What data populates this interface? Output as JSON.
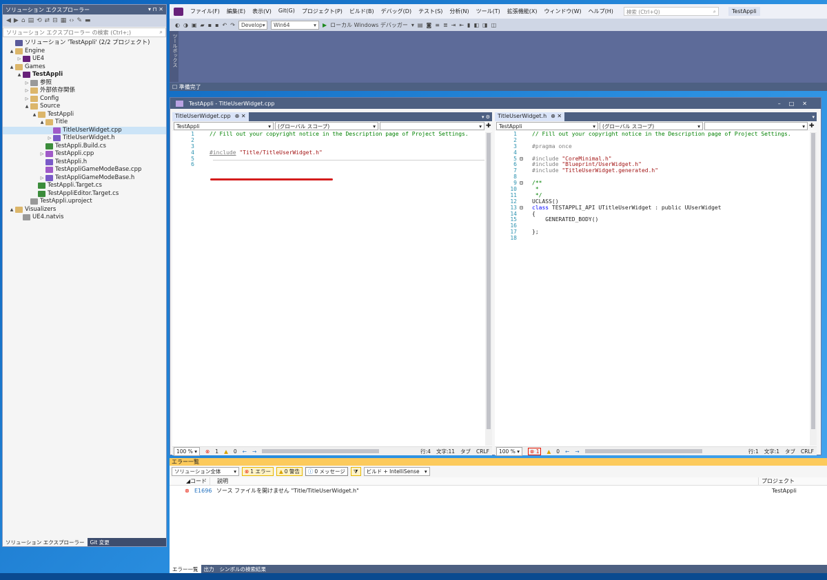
{
  "solution_explorer": {
    "title": "ソリューション エクスプローラー",
    "title_controls": "▾ ⊓ ✕",
    "search_placeholder": "ソリューション エクスプローラー の検索 (Ctrl+;)",
    "tree": [
      {
        "label": "ソリューション 'TestAppli' (2/2 プロジェクト)",
        "depth": 0,
        "expand": "",
        "icon": "solution-icon",
        "bold": false
      },
      {
        "label": "Engine",
        "depth": 0,
        "expand": "▲",
        "icon": "folder-icon",
        "bold": false
      },
      {
        "label": "UE4",
        "depth": 1,
        "expand": "▷",
        "icon": "project-icon",
        "bold": false
      },
      {
        "label": "Games",
        "depth": 0,
        "expand": "▲",
        "icon": "folder-icon",
        "bold": false
      },
      {
        "label": "TestAppli",
        "depth": 1,
        "expand": "▲",
        "icon": "project-icon",
        "bold": true
      },
      {
        "label": "参照",
        "depth": 2,
        "expand": "▷",
        "icon": "references-icon",
        "bold": false
      },
      {
        "label": "外部依存関係",
        "depth": 2,
        "expand": "▷",
        "icon": "external-deps-icon",
        "bold": false
      },
      {
        "label": "Config",
        "depth": 2,
        "expand": "▷",
        "icon": "folder-icon",
        "bold": false
      },
      {
        "label": "Source",
        "depth": 2,
        "expand": "▲",
        "icon": "folder-icon",
        "bold": false
      },
      {
        "label": "TestAppli",
        "depth": 3,
        "expand": "▲",
        "icon": "folder-icon",
        "bold": false
      },
      {
        "label": "Title",
        "depth": 4,
        "expand": "▲",
        "icon": "folder-icon",
        "bold": false
      },
      {
        "label": "TitleUserWidget.cpp",
        "depth": 5,
        "expand": "",
        "icon": "cpp-file-icon",
        "bold": false,
        "selected": true
      },
      {
        "label": "TitleUserWidget.h",
        "depth": 5,
        "expand": "▷",
        "icon": "header-file-icon",
        "bold": false
      },
      {
        "label": "TestAppli.Build.cs",
        "depth": 4,
        "expand": "",
        "icon": "cs-file-icon",
        "bold": false
      },
      {
        "label": "TestAppli.cpp",
        "depth": 4,
        "expand": "▷",
        "icon": "cpp-file-icon",
        "bold": false
      },
      {
        "label": "TestAppli.h",
        "depth": 4,
        "expand": "",
        "icon": "header-file-icon",
        "bold": false
      },
      {
        "label": "TestAppliGameModeBase.cpp",
        "depth": 4,
        "expand": "",
        "icon": "cpp-file-icon",
        "bold": false
      },
      {
        "label": "TestAppliGameModeBase.h",
        "depth": 4,
        "expand": "▷",
        "icon": "header-file-icon",
        "bold": false
      },
      {
        "label": "TestAppli.Target.cs",
        "depth": 3,
        "expand": "",
        "icon": "cs-file-icon",
        "bold": false
      },
      {
        "label": "TestAppliEditor.Target.cs",
        "depth": 3,
        "expand": "",
        "icon": "cs-file-icon",
        "bold": false
      },
      {
        "label": "TestAppli.uproject",
        "depth": 2,
        "expand": "",
        "icon": "uproject-file-icon",
        "bold": false
      },
      {
        "label": "Visualizers",
        "depth": 0,
        "expand": "▲",
        "icon": "folder-icon",
        "bold": false
      },
      {
        "label": "UE4.natvis",
        "depth": 1,
        "expand": "",
        "icon": "natvis-file-icon",
        "bold": false
      }
    ],
    "bottom_tabs": [
      "ソリューション エクスプローラー",
      "Git 変更"
    ]
  },
  "menu": {
    "items": [
      "ファイル(F)",
      "編集(E)",
      "表示(V)",
      "Git(G)",
      "プロジェクト(P)",
      "ビルド(B)",
      "デバッグ(D)",
      "テスト(S)",
      "分析(N)",
      "ツール(T)",
      "拡張機能(X)",
      "ウィンドウ(W)",
      "ヘルプ(H)"
    ],
    "search_placeholder": "検索 (Ctrl+Q)",
    "project_name": "TestAppli"
  },
  "toolbar": {
    "config": "Develop",
    "platform": "Win64",
    "debugger": "ローカル Windows デバッガー"
  },
  "toolbox_label": "ツールボックス",
  "main_status": "準備完了",
  "editor_window": {
    "title": "TestAppli - TitleUserWidget.cpp",
    "left": {
      "tab": "TitleUserWidget.cpp",
      "tab_icons": "⊕ ✕",
      "scope_project": "TestAppli",
      "scope": "(グローバル スコープ)",
      "zoom": "100 %",
      "errors": "1",
      "warnings": "0",
      "position": "行:4",
      "column": "文字:11",
      "tab_mode": "タブ",
      "line_ending": "CRLF",
      "lines": [
        {
          "n": "1",
          "text": "// Fill out your copyright notice in the Description page of Project Settings.",
          "cls": "cm"
        },
        {
          "n": "2",
          "text": "",
          "cls": ""
        },
        {
          "n": "3",
          "text": "",
          "cls": ""
        },
        {
          "n": "4",
          "pre": "#include",
          "text": " \"Title/TitleUserWidget.h\"",
          "cls": "st"
        },
        {
          "n": "5",
          "text": "",
          "cls": ""
        },
        {
          "n": "6",
          "text": "",
          "cls": ""
        }
      ]
    },
    "right": {
      "tab": "TitleUserWidget.h",
      "tab_icons": "⊕ ✕",
      "scope_project": "TestAppli",
      "scope": "(グローバル スコープ)",
      "zoom": "100 %",
      "errors": "1",
      "warnings": "0",
      "position": "行:1",
      "column": "文字:1",
      "tab_mode": "タブ",
      "line_ending": "CRLF",
      "lines": [
        {
          "n": "1",
          "text": "// Fill out your copyright notice in the Description page of Project Settings.",
          "cls": "cm"
        },
        {
          "n": "2",
          "text": "",
          "cls": ""
        },
        {
          "n": "3",
          "text": "#pragma once",
          "cls": "pp"
        },
        {
          "n": "4",
          "text": "",
          "cls": ""
        },
        {
          "n": "5",
          "pre": "#include",
          "text": " \"CoreMinimal.h\"",
          "cls": "st",
          "fold": "⊟"
        },
        {
          "n": "6",
          "pre": "#include",
          "text": " \"Blueprint/UserWidget.h\"",
          "cls": "st"
        },
        {
          "n": "7",
          "pre": "#include",
          "text": " \"TitleUserWidget.generated.h\"",
          "cls": "st"
        },
        {
          "n": "8",
          "text": "",
          "cls": ""
        },
        {
          "n": "9",
          "text": "/**",
          "cls": "cm",
          "fold": "⊟"
        },
        {
          "n": "10",
          "text": " *",
          "cls": "cm"
        },
        {
          "n": "11",
          "text": " */",
          "cls": "cm"
        },
        {
          "n": "12",
          "text": "UCLASS()",
          "cls": ""
        },
        {
          "n": "13",
          "pre": "class",
          "text": " TESTAPPLI_API UTitleUserWidget : public UUserWidget",
          "cls": "",
          "fold": "⊟"
        },
        {
          "n": "14",
          "text": "{",
          "cls": ""
        },
        {
          "n": "15",
          "text": "    GENERATED_BODY()",
          "cls": ""
        },
        {
          "n": "16",
          "text": "",
          "cls": ""
        },
        {
          "n": "17",
          "text": "};",
          "cls": ""
        },
        {
          "n": "18",
          "text": "",
          "cls": ""
        }
      ]
    }
  },
  "error_list": {
    "title": "エラー一覧",
    "scope": "ソリューション全体",
    "errors_label": "1 エラー",
    "warnings_label": "0 警告",
    "messages_label": "0 メッセージ",
    "build_filter": "ビルド + IntelliSense",
    "columns": {
      "code": "コード",
      "desc": "説明",
      "project": "プロジェクト"
    },
    "rows": [
      {
        "code": "E1696",
        "desc": "ソース ファイルを開けません \"Title/TitleUserWidget.h\"",
        "project": "TestAppli"
      }
    ],
    "bottom_tabs": [
      "エラー一覧",
      "出力",
      "シンボルの検索結果"
    ]
  },
  "colors": {
    "accent": "#68217a",
    "error": "#e51400",
    "highlight_underline": "#d41c1c"
  }
}
